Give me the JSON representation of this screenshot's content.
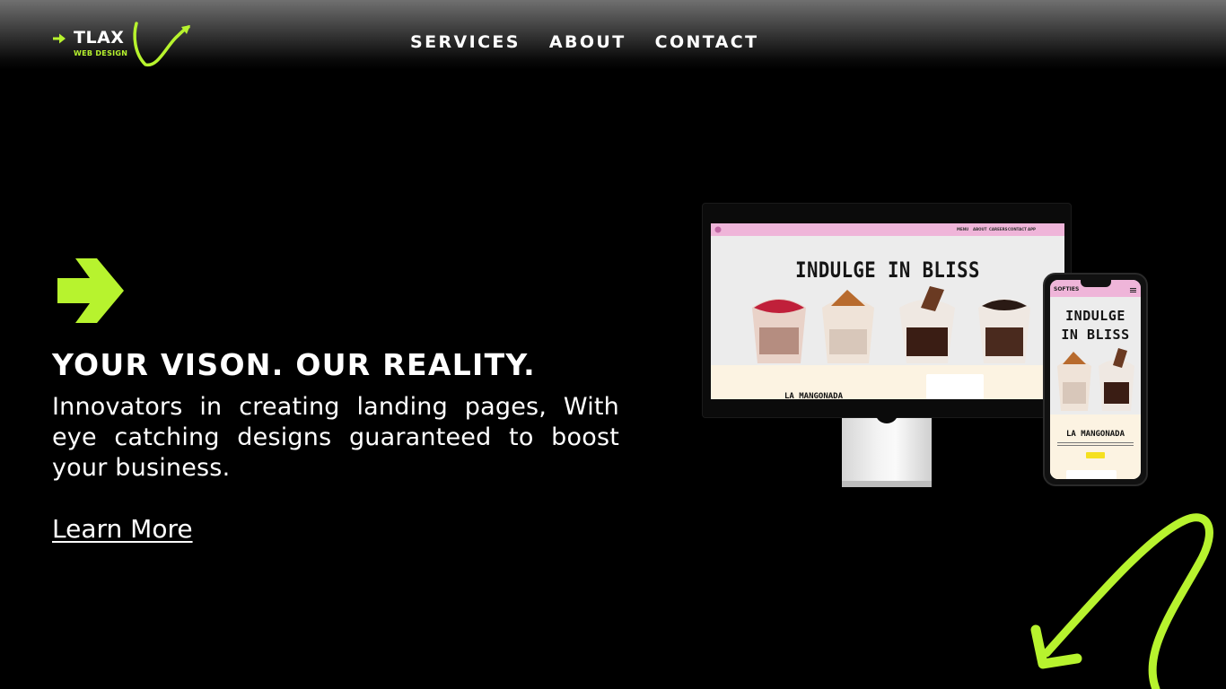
{
  "header": {
    "logo": {
      "name": "TLAX",
      "subtitle": "WEB DESIGN"
    },
    "nav": [
      {
        "label": "SERVICES"
      },
      {
        "label": "ABOUT"
      },
      {
        "label": "CONTACT"
      }
    ]
  },
  "hero": {
    "title": "YOUR VISON. OUR REALITY.",
    "description": "Innovators in creating landing pages, With eye catching designs guaranteed to boost your business.",
    "cta": "Learn More"
  },
  "mockup": {
    "desktop": {
      "nav_items": [
        "MENU",
        "ABOUT",
        "CAREERS",
        "CONTACT",
        "APP"
      ],
      "headline": "INDULGE IN BLISS",
      "section_title": "LA MANGONADA"
    },
    "phone": {
      "brand": "SOFTIES",
      "headline_line1": "INDULGE",
      "headline_line2": "IN BLISS",
      "section_title": "LA MANGONADA"
    }
  },
  "colors": {
    "accent": "#b7f32e",
    "background": "#000000",
    "mockup_nav": "#efb5d9",
    "mockup_cream": "#fcf3e2"
  },
  "icons": {
    "logo_arrow": "arrow-right-icon",
    "hero_arrow": "arrow-right-icon",
    "decor": "swoosh-arrow-icon"
  }
}
